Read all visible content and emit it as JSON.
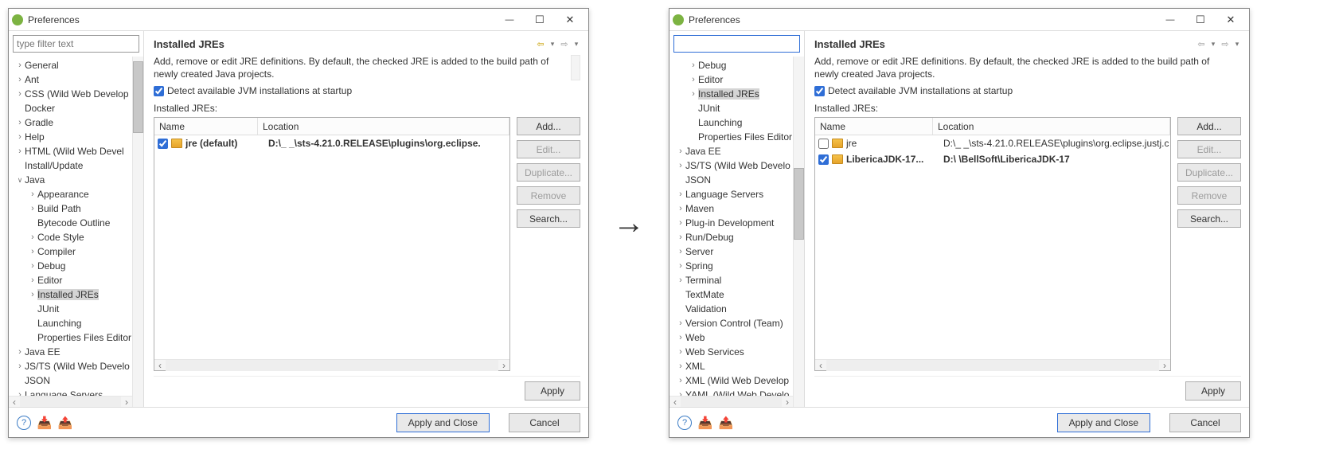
{
  "left": {
    "title": "Preferences",
    "filter_placeholder": "type filter text",
    "page_title": "Installed JREs",
    "desc": "Add, remove or edit JRE definitions. By default, the checked JRE is added to the build path of newly created Java projects.",
    "detect_label": "Detect available JVM installations at startup",
    "detect_checked": true,
    "section_label": "Installed JREs:",
    "columns": {
      "name": "Name",
      "location": "Location"
    },
    "rows": [
      {
        "checked": true,
        "name_bold": true,
        "name": "jre (default)",
        "location": "D:\\_       _\\sts-4.21.0.RELEASE\\plugins\\org.eclipse."
      }
    ],
    "buttons": {
      "add": "Add...",
      "edit": "Edit...",
      "duplicate": "Duplicate...",
      "remove": "Remove",
      "search": "Search..."
    },
    "apply_label": "Apply",
    "apply_close": "Apply and Close",
    "cancel": "Cancel",
    "tree": [
      {
        "d": 0,
        "ar": "col",
        "lbl": "General"
      },
      {
        "d": 0,
        "ar": "col",
        "lbl": "Ant"
      },
      {
        "d": 0,
        "ar": "col",
        "lbl": "CSS (Wild Web Develop"
      },
      {
        "d": 0,
        "ar": "none",
        "lbl": "Docker"
      },
      {
        "d": 0,
        "ar": "col",
        "lbl": "Gradle"
      },
      {
        "d": 0,
        "ar": "col",
        "lbl": "Help"
      },
      {
        "d": 0,
        "ar": "col",
        "lbl": "HTML (Wild Web Devel"
      },
      {
        "d": 0,
        "ar": "none",
        "lbl": "Install/Update"
      },
      {
        "d": 0,
        "ar": "exp",
        "lbl": "Java"
      },
      {
        "d": 1,
        "ar": "col",
        "lbl": "Appearance"
      },
      {
        "d": 1,
        "ar": "col",
        "lbl": "Build Path"
      },
      {
        "d": 1,
        "ar": "none",
        "lbl": "Bytecode Outline"
      },
      {
        "d": 1,
        "ar": "col",
        "lbl": "Code Style"
      },
      {
        "d": 1,
        "ar": "col",
        "lbl": "Compiler"
      },
      {
        "d": 1,
        "ar": "col",
        "lbl": "Debug"
      },
      {
        "d": 1,
        "ar": "col",
        "lbl": "Editor"
      },
      {
        "d": 1,
        "ar": "col",
        "lbl": "Installed JREs",
        "sel": true
      },
      {
        "d": 1,
        "ar": "none",
        "lbl": "JUnit"
      },
      {
        "d": 1,
        "ar": "none",
        "lbl": "Launching"
      },
      {
        "d": 1,
        "ar": "none",
        "lbl": "Properties Files Editor"
      },
      {
        "d": 0,
        "ar": "col",
        "lbl": "Java EE"
      },
      {
        "d": 0,
        "ar": "col",
        "lbl": "JS/TS (Wild Web Develo"
      },
      {
        "d": 0,
        "ar": "none",
        "lbl": "JSON"
      },
      {
        "d": 0,
        "ar": "col",
        "lbl": "Language Servers"
      }
    ]
  },
  "right": {
    "title": "Preferences",
    "filter_placeholder": "",
    "page_title": "Installed JREs",
    "desc": "Add, remove or edit JRE definitions. By default, the checked JRE is added to the build path of newly created Java projects.",
    "detect_label": "Detect available JVM installations at startup",
    "detect_checked": true,
    "section_label": "Installed JREs:",
    "columns": {
      "name": "Name",
      "location": "Location"
    },
    "rows": [
      {
        "checked": false,
        "name_bold": false,
        "name": "jre",
        "location": "D:\\_       _\\sts-4.21.0.RELEASE\\plugins\\org.eclipse.justj.c"
      },
      {
        "checked": true,
        "name_bold": true,
        "name": "LibericaJDK-17...",
        "location": "D:\\       \\BellSoft\\LibericaJDK-17"
      }
    ],
    "buttons": {
      "add": "Add...",
      "edit": "Edit...",
      "duplicate": "Duplicate...",
      "remove": "Remove",
      "search": "Search..."
    },
    "apply_label": "Apply",
    "apply_close": "Apply and Close",
    "cancel": "Cancel",
    "tree": [
      {
        "d": 1,
        "ar": "col",
        "lbl": "Debug"
      },
      {
        "d": 1,
        "ar": "col",
        "lbl": "Editor"
      },
      {
        "d": 1,
        "ar": "col",
        "lbl": "Installed JREs",
        "sel": true
      },
      {
        "d": 1,
        "ar": "none",
        "lbl": "JUnit"
      },
      {
        "d": 1,
        "ar": "none",
        "lbl": "Launching"
      },
      {
        "d": 1,
        "ar": "none",
        "lbl": "Properties Files Editor"
      },
      {
        "d": 0,
        "ar": "col",
        "lbl": "Java EE"
      },
      {
        "d": 0,
        "ar": "col",
        "lbl": "JS/TS (Wild Web Develo"
      },
      {
        "d": 0,
        "ar": "none",
        "lbl": "JSON"
      },
      {
        "d": 0,
        "ar": "col",
        "lbl": "Language Servers"
      },
      {
        "d": 0,
        "ar": "col",
        "lbl": "Maven"
      },
      {
        "d": 0,
        "ar": "col",
        "lbl": "Plug-in Development"
      },
      {
        "d": 0,
        "ar": "col",
        "lbl": "Run/Debug"
      },
      {
        "d": 0,
        "ar": "col",
        "lbl": "Server"
      },
      {
        "d": 0,
        "ar": "col",
        "lbl": "Spring"
      },
      {
        "d": 0,
        "ar": "col",
        "lbl": "Terminal"
      },
      {
        "d": 0,
        "ar": "none",
        "lbl": "TextMate"
      },
      {
        "d": 0,
        "ar": "none",
        "lbl": "Validation"
      },
      {
        "d": 0,
        "ar": "col",
        "lbl": "Version Control (Team)"
      },
      {
        "d": 0,
        "ar": "col",
        "lbl": "Web"
      },
      {
        "d": 0,
        "ar": "col",
        "lbl": "Web Services"
      },
      {
        "d": 0,
        "ar": "col",
        "lbl": "XML"
      },
      {
        "d": 0,
        "ar": "col",
        "lbl": "XML (Wild Web Develop"
      },
      {
        "d": 0,
        "ar": "col",
        "lbl": "YAML (Wild Web Develo"
      }
    ]
  }
}
